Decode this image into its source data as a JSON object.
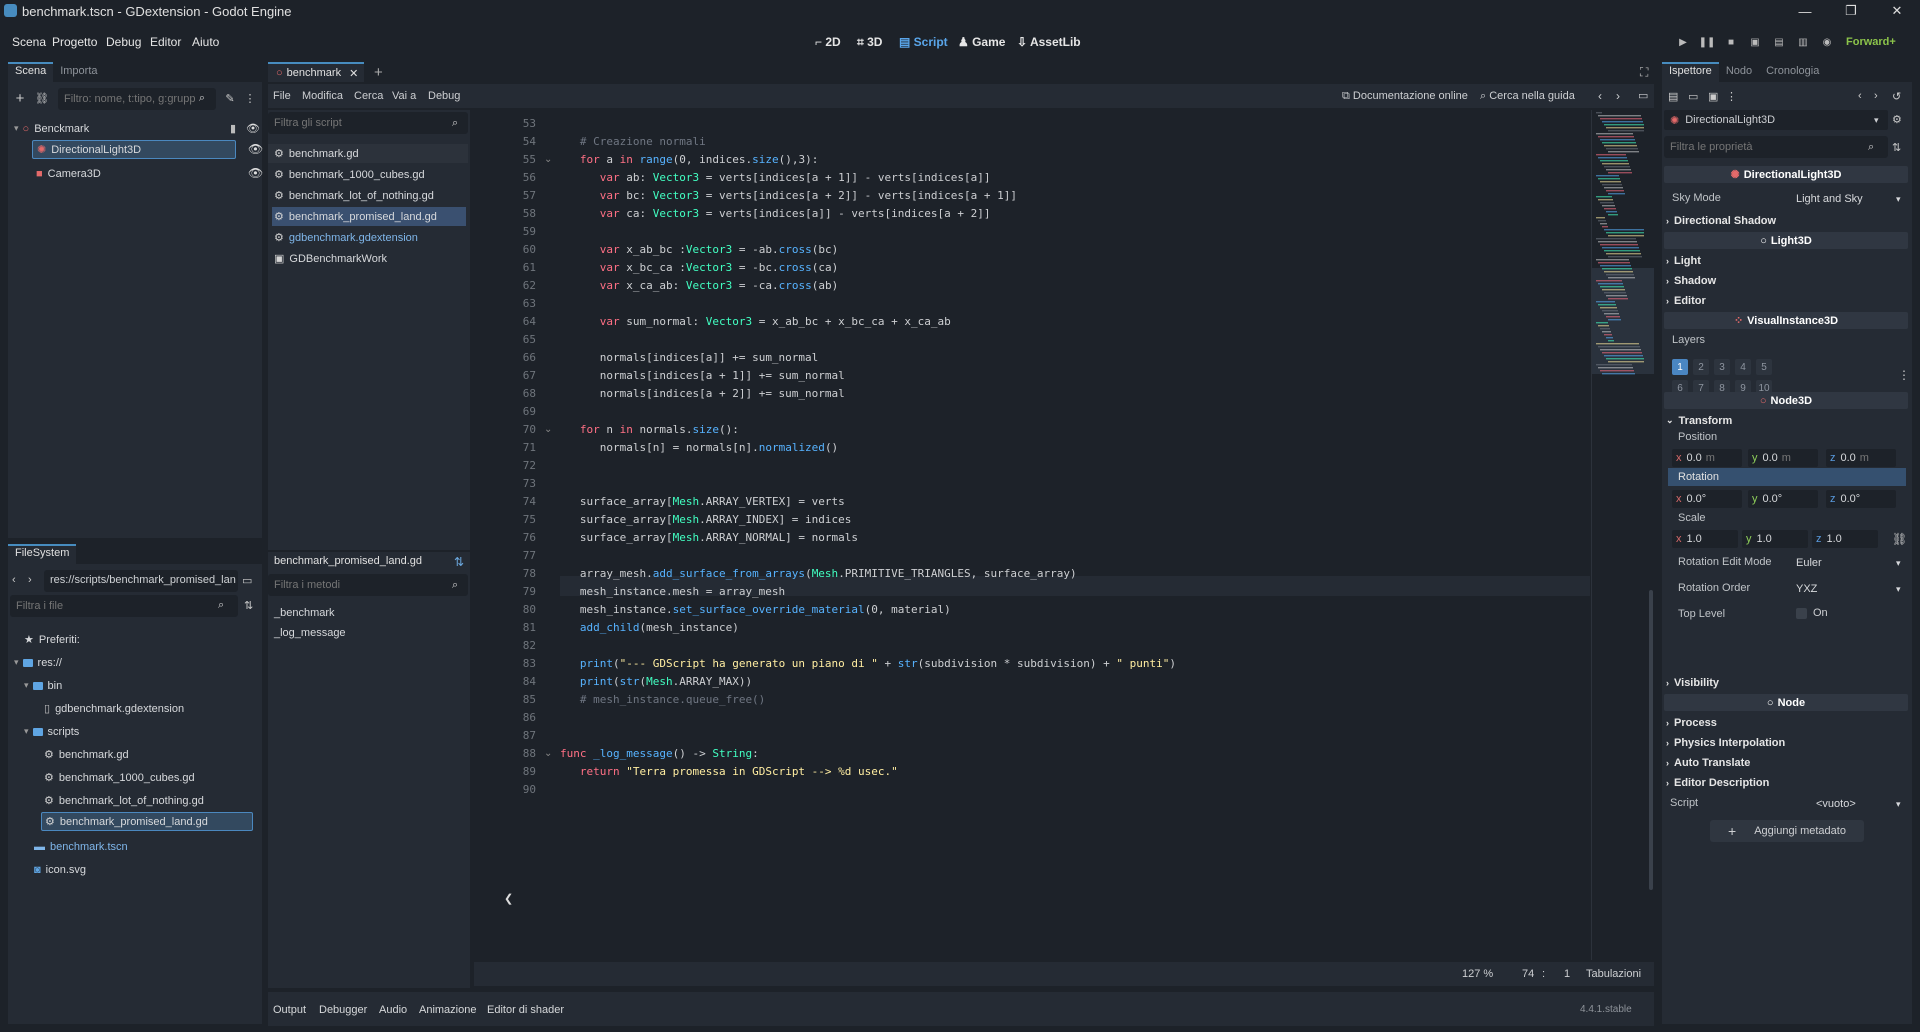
{
  "window": {
    "title": "benchmark.tscn - GDextension - Godot Engine"
  },
  "menu": [
    "Scena",
    "Progetto",
    "Debug",
    "Editor",
    "Aiuto"
  ],
  "workspaces": [
    "2D",
    "3D",
    "Script",
    "Game",
    "AssetLib"
  ],
  "renderer": "Forward+",
  "scene_dock": {
    "tabs": [
      "Scena",
      "Importa"
    ],
    "filter_placeholder": "Filtro: nome, t:tipo, g:grupp",
    "nodes": [
      {
        "name": "Benckmark"
      },
      {
        "name": "DirectionalLight3D"
      },
      {
        "name": "Camera3D"
      }
    ]
  },
  "fs_dock": {
    "tab": "FileSystem",
    "path": "res://scripts/benchmark_promised_lan",
    "filter_placeholder": "Filtra i file",
    "favorites": "Preferiti:",
    "root": "res://",
    "bin": "bin",
    "gdextension": "gdbenchmark.gdextension",
    "scripts_folder": "scripts",
    "scripts": [
      "benchmark.gd",
      "benchmark_1000_cubes.gd",
      "benchmark_lot_of_nothing.gd",
      "benchmark_promised_land.gd"
    ],
    "tscn": "benchmark.tscn",
    "icon": "icon.svg"
  },
  "editor": {
    "tab": "benchmark",
    "menu": [
      "File",
      "Modifica",
      "Cerca",
      "Vai a",
      "Debug"
    ],
    "doc_online": "Documentazione online",
    "search_help": "Cerca nella guida",
    "filter_scripts_placeholder": "Filtra gli script",
    "scripts": [
      "benchmark.gd",
      "benchmark_1000_cubes.gd",
      "benchmark_lot_of_nothing.gd",
      "benchmark_promised_land.gd",
      "gdbenchmark.gdextension",
      "GDBenchmarkWork"
    ],
    "current_script": "benchmark_promised_land.gd",
    "filter_methods_placeholder": "Filtra i metodi",
    "methods": [
      "_benchmark",
      "_log_message"
    ],
    "zoom": "127 %",
    "line": "74",
    "col": "1",
    "indent": "Tabulazioni"
  },
  "code": [
    {
      "n": "53",
      "h": ""
    },
    {
      "n": "54",
      "h": "\t<span class=\"cm\"># Creazione normali</span>"
    },
    {
      "n": "55",
      "h": "\t<span class=\"kw\">for</span> a <span class=\"kw\">in</span> <span class=\"fn\">range</span>(0, indices.<span class=\"fn\">size</span>(),3):"
    },
    {
      "n": "56",
      "h": "\t\t<span class=\"kw\">var</span> ab: <span class=\"ty\">Vector3</span> = verts[indices[a + 1]] - verts[indices[a]]"
    },
    {
      "n": "57",
      "h": "\t\t<span class=\"kw\">var</span> bc: <span class=\"ty\">Vector3</span> = verts[indices[a + 2]] - verts[indices[a + 1]]"
    },
    {
      "n": "58",
      "h": "\t\t<span class=\"kw\">var</span> ca: <span class=\"ty\">Vector3</span> = verts[indices[a]] - verts[indices[a + 2]]"
    },
    {
      "n": "59",
      "h": ""
    },
    {
      "n": "60",
      "h": "\t\t<span class=\"kw\">var</span> x_ab_bc :<span class=\"ty\">Vector3</span> = -ab.<span class=\"fn\">cross</span>(bc)"
    },
    {
      "n": "61",
      "h": "\t\t<span class=\"kw\">var</span> x_bc_ca :<span class=\"ty\">Vector3</span> = -bc.<span class=\"fn\">cross</span>(ca)"
    },
    {
      "n": "62",
      "h": "\t\t<span class=\"kw\">var</span> x_ca_ab: <span class=\"ty\">Vector3</span> = -ca.<span class=\"fn\">cross</span>(ab)"
    },
    {
      "n": "63",
      "h": ""
    },
    {
      "n": "64",
      "h": "\t\t<span class=\"kw\">var</span> sum_normal: <span class=\"ty\">Vector3</span> = x_ab_bc + x_bc_ca + x_ca_ab"
    },
    {
      "n": "65",
      "h": ""
    },
    {
      "n": "66",
      "h": "\t\tnormals[indices[a]] += sum_normal"
    },
    {
      "n": "67",
      "h": "\t\tnormals[indices[a + 1]] += sum_normal"
    },
    {
      "n": "68",
      "h": "\t\tnormals[indices[a + 2]] += sum_normal"
    },
    {
      "n": "69",
      "h": ""
    },
    {
      "n": "70",
      "h": "\t<span class=\"kw\">for</span> n <span class=\"kw\">in</span> normals.<span class=\"fn\">size</span>():"
    },
    {
      "n": "71",
      "h": "\t\tnormals[n] = normals[n].<span class=\"fn\">normalized</span>()"
    },
    {
      "n": "72",
      "h": ""
    },
    {
      "n": "73",
      "h": ""
    },
    {
      "n": "74",
      "h": "\tsurface_array[<span class=\"ty\">Mesh</span>.ARRAY_VERTEX] = verts"
    },
    {
      "n": "75",
      "h": "\tsurface_array[<span class=\"ty\">Mesh</span>.ARRAY_INDEX] = indices"
    },
    {
      "n": "76",
      "h": "\tsurface_array[<span class=\"ty\">Mesh</span>.ARRAY_NORMAL] = normals"
    },
    {
      "n": "77",
      "h": ""
    },
    {
      "n": "78",
      "h": "\tarray_mesh.<span class=\"fn\">add_surface_from_arrays</span>(<span class=\"ty\">Mesh</span>.PRIMITIVE_TRIANGLES, surface_array)"
    },
    {
      "n": "79",
      "h": "\tmesh_instance.mesh = array_mesh"
    },
    {
      "n": "80",
      "h": "\tmesh_instance.<span class=\"fn\">set_surface_override_material</span>(0, material)"
    },
    {
      "n": "81",
      "h": "\t<span class=\"fn\">add_child</span>(mesh_instance)"
    },
    {
      "n": "82",
      "h": ""
    },
    {
      "n": "83",
      "h": "\t<span class=\"fn\">print</span>(<span class=\"st\">\"--- GDScript ha generato un piano di \"</span> + <span class=\"fn\">str</span>(subdivision * subdivision) + <span class=\"st\">\" punti\"</span>)"
    },
    {
      "n": "84",
      "h": "\t<span class=\"fn\">print</span>(<span class=\"fn\">str</span>(<span class=\"ty\">Mesh</span>.ARRAY_MAX))"
    },
    {
      "n": "85",
      "h": "\t<span class=\"cm\"># mesh_instance.queue_free()</span>"
    },
    {
      "n": "86",
      "h": ""
    },
    {
      "n": "87",
      "h": ""
    },
    {
      "n": "88",
      "h": "<span class=\"kw\">func</span> <span class=\"fn\">_log_message</span>() -> <span class=\"ty\">String</span>:"
    },
    {
      "n": "89",
      "h": "\t<span class=\"kw\">return</span> <span class=\"st\">\"Terra promessa in GDScript --> %d usec.\"</span>"
    },
    {
      "n": "90",
      "h": ""
    }
  ],
  "bottom": {
    "tabs": [
      "Output",
      "Debugger",
      "Audio",
      "Animazione",
      "Editor di shader"
    ],
    "version": "4.4.1.stable"
  },
  "inspector": {
    "tabs": [
      "Ispettore",
      "Nodo",
      "Cronologia"
    ],
    "object": "DirectionalLight3D",
    "filter_placeholder": "Filtra le proprietà",
    "class_title": "DirectionalLight3D",
    "sky_mode_label": "Sky Mode",
    "sky_mode_value": "Light and Sky",
    "dir_shadow": "Directional Shadow",
    "light3d": "Light3D",
    "light": "Light",
    "shadow": "Shadow",
    "editor": "Editor",
    "visual": "VisualInstance3D",
    "layers_label": "Layers",
    "layers": [
      "1",
      "2",
      "3",
      "4",
      "5",
      "6",
      "7",
      "8",
      "9",
      "10"
    ],
    "node3d": "Node3D",
    "transform": "Transform",
    "position": "Position",
    "pos": {
      "x": "0.0",
      "y": "0.0",
      "z": "0.0",
      "unit": "m"
    },
    "rotation": "Rotation",
    "rot": {
      "x": "0.0",
      "y": "0.0",
      "z": "0.0",
      "unit": "°"
    },
    "scale": "Scale",
    "scl": {
      "x": "1.0",
      "y": "1.0",
      "z": "1.0"
    },
    "rot_edit_mode_label": "Rotation Edit Mode",
    "rot_edit_mode": "Euler",
    "rot_order_label": "Rotation Order",
    "rot_order": "YXZ",
    "top_level_label": "Top Level",
    "top_level": "On",
    "visibility": "Visibility",
    "node": "Node",
    "process": "Process",
    "physics": "Physics Interpolation",
    "auto_translate": "Auto Translate",
    "editor_desc": "Editor Description",
    "script_label": "Script",
    "script_value": "<vuoto>",
    "add_metadata": "Aggiungi metadato"
  },
  "axes": {
    "x": "x",
    "y": "y",
    "z": "z"
  }
}
